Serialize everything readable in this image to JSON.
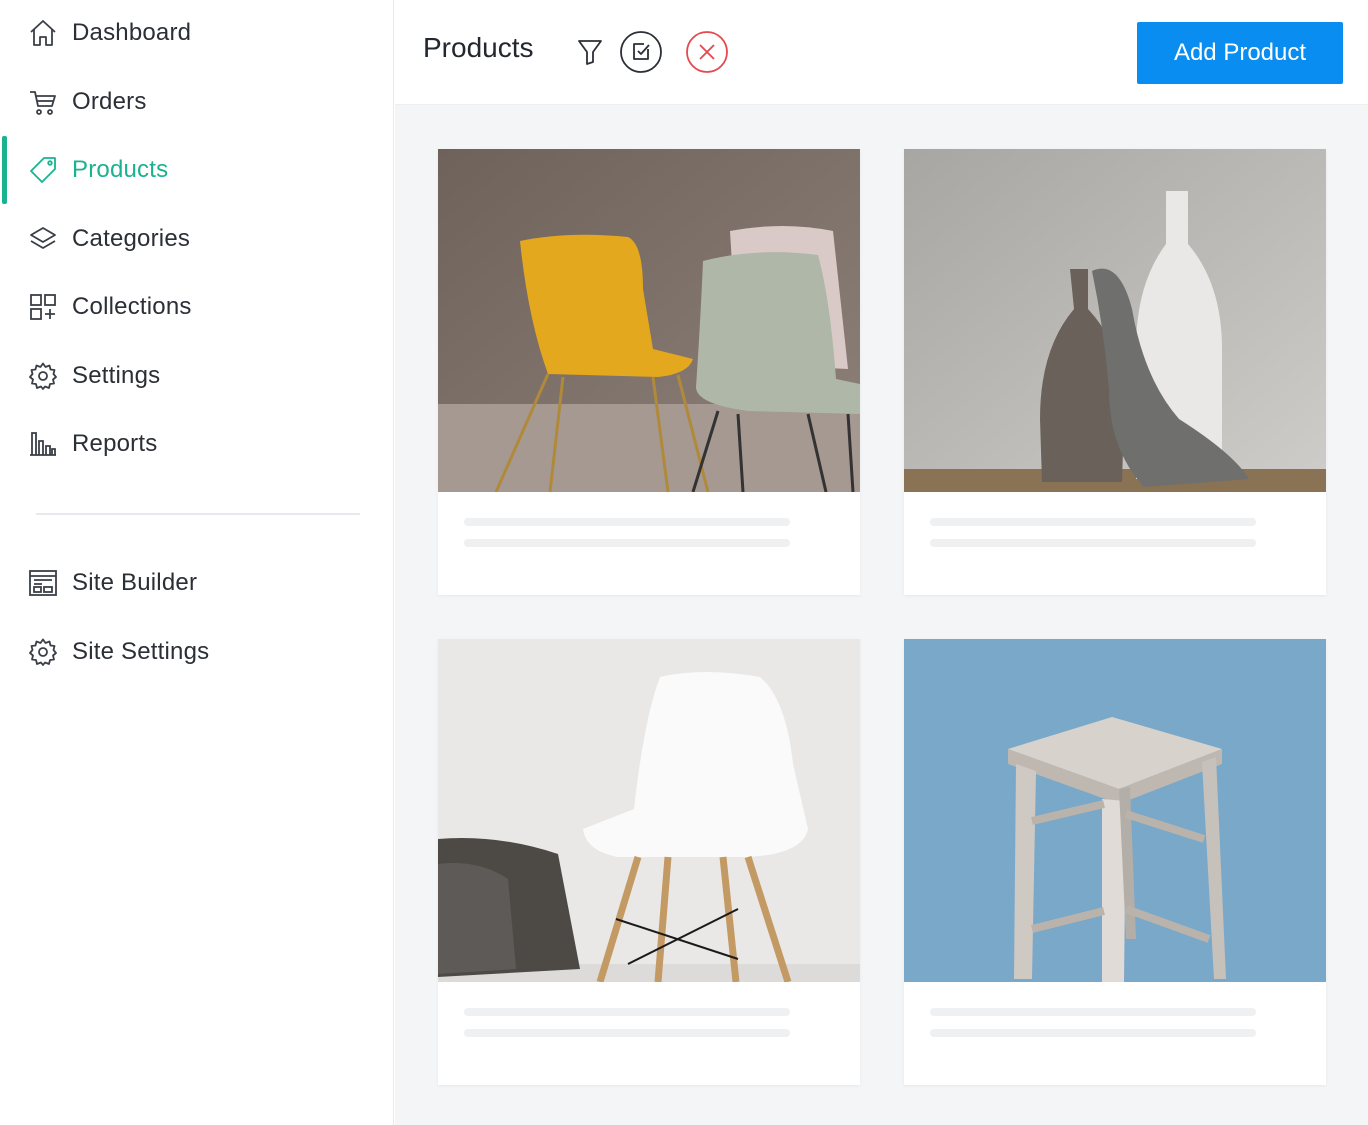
{
  "sidebar": {
    "items": [
      {
        "label": "Dashboard",
        "icon": "home-icon"
      },
      {
        "label": "Orders",
        "icon": "cart-icon"
      },
      {
        "label": "Products",
        "icon": "tag-icon",
        "active": true
      },
      {
        "label": "Categories",
        "icon": "layers-icon"
      },
      {
        "label": "Collections",
        "icon": "grid-plus-icon"
      },
      {
        "label": "Settings",
        "icon": "gear-icon"
      },
      {
        "label": "Reports",
        "icon": "bar-chart-icon"
      }
    ],
    "site_items": [
      {
        "label": "Site Builder",
        "icon": "site-builder-icon"
      },
      {
        "label": "Site Settings",
        "icon": "gear-icon"
      }
    ]
  },
  "header": {
    "title": "Products",
    "add_button": "Add Product",
    "icons": [
      "filter-icon",
      "bulk-edit-icon",
      "close-circle-icon"
    ]
  },
  "products": [
    {
      "image": "chairs-photo"
    },
    {
      "image": "vases-photo"
    },
    {
      "image": "white-chair-photo"
    },
    {
      "image": "stool-photo"
    }
  ],
  "colors": {
    "accent": "#19b38f",
    "primary_button": "#0a8df0",
    "danger": "#e5484d",
    "page_background": "#f3f5f7"
  }
}
